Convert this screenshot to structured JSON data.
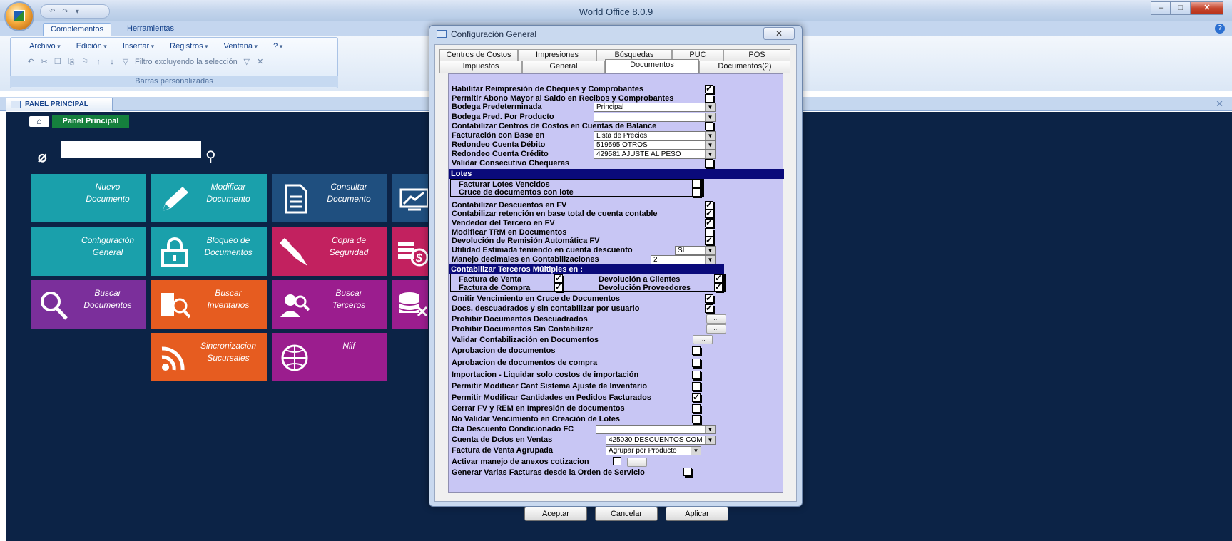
{
  "window": {
    "title": "World Office 8.0.9",
    "controls": [
      "minimize",
      "maximize",
      "close"
    ]
  },
  "ribbon": {
    "tabs": [
      "Complementos",
      "Herramientas"
    ],
    "active_tab": "Complementos",
    "menus": [
      "Archivo",
      "Edición",
      "Insertar",
      "Registros",
      "Ventana",
      "?"
    ],
    "filter_label": "Filtro excluyendo la selección",
    "group_label": "Barras personalizadas"
  },
  "doc_tab": {
    "title": "PANEL PRINCIPAL"
  },
  "panel": {
    "home_label": "Panel Principal",
    "search_value": "",
    "tiles": [
      {
        "label": "Nuevo\nDocumento",
        "icon": "new-document-icon",
        "color": "#1aa0ab"
      },
      {
        "label": "Modificar\nDocumento",
        "icon": "pencil-icon",
        "color": "#1aa0ab"
      },
      {
        "label": "Consultar\nDocumento",
        "icon": "document-icon",
        "color": "#1f4f7f"
      },
      {
        "label": "",
        "icon": "chart-icon",
        "color": "#1f4f7f"
      },
      {
        "label": "Configuración\nGeneral",
        "icon": "settings-icon",
        "color": "#1aa0ab"
      },
      {
        "label": "Bloqueo de\nDocumentos",
        "icon": "lock-icon",
        "color": "#1aa0ab"
      },
      {
        "label": "Copia de\nSeguridad",
        "icon": "usb-icon",
        "color": "#c2215f"
      },
      {
        "label": "",
        "icon": "money-icon",
        "color": "#c2215f"
      },
      {
        "label": "Buscar\nDocumentos",
        "icon": "magnifier-icon",
        "color": "#7b2f9b"
      },
      {
        "label": "Buscar\nInventarios",
        "icon": "inventory-search-icon",
        "color": "#e65c20"
      },
      {
        "label": "Buscar\nTerceros",
        "icon": "people-search-icon",
        "color": "#9b1d8e"
      },
      {
        "label": "",
        "icon": "database-icon",
        "color": "#9b1d8e"
      },
      {
        "label": "Sincronizacion\nSucursales",
        "icon": "rss-icon",
        "color": "#e65c20"
      },
      {
        "label": "Niif",
        "icon": "globe-icon",
        "color": "#9b1d8e"
      }
    ]
  },
  "dialog": {
    "title": "Configuración General",
    "tabs_row1": [
      "Centros de Costos",
      "Impresiones",
      "Búsquedas",
      "PUC",
      "POS"
    ],
    "tabs_row2": [
      "Impuestos",
      "General",
      "Documentos",
      "Documentos(2)"
    ],
    "active_tab": "Documentos",
    "rows": {
      "reimpresion": "Habilitar Reimpresión de Cheques y Comprobantes",
      "abono": "Permitir Abono Mayor al Saldo en Recibos y Comprobantes",
      "bodega": "Bodega Predeterminada",
      "bodega_value": "Principal",
      "bodega_prod": "Bodega Pred. Por Producto",
      "bodega_prod_value": "",
      "centros": "Contabilizar Centros de Costos en Cuentas de Balance",
      "facturacion": "Facturación con Base en",
      "facturacion_value": "Lista de Precios",
      "redondeo_deb": "Redondeo Cuenta Débito",
      "redondeo_deb_value": "519595 OTROS",
      "redondeo_cred": "Redondeo Cuenta Crédito",
      "redondeo_cred_value": "429581 AJUSTE AL PESO",
      "validar_chequeras": "Validar Consecutivo Chequeras",
      "lotes_header": "Lotes",
      "lotes_vencidos": "Facturar Lotes Vencidos",
      "lotes_cruce": "Cruce de documentos con lote",
      "descuentos_fv": "Contabilizar Descuentos en FV",
      "retencion": "Contabilizar retención en base total de cuenta contable",
      "vendedor": "Vendedor del Tercero en FV",
      "trm": "Modificar TRM en Documentos",
      "devolucion_rem": "Devolución de Remisión Automática FV",
      "utilidad": "Utilidad Estimada teniendo en cuenta descuento",
      "utilidad_value": "SI",
      "decimales": "Manejo decimales en Contabilizaciones",
      "decimales_value": "2",
      "terceros_header": "Contabilizar Terceros Múltiples en :",
      "factura_venta": "Factura de Venta",
      "factura_compra": "Factura de Compra",
      "devolucion_clientes": "Devolución a Clientes",
      "devolucion_proveedores": "Devolución Proveedores",
      "omitir_venc": "Omitir Vencimiento en Cruce de Documentos",
      "descuadrados_usuario": "Docs. descuadrados y sin contabilizar por usuario",
      "prohibir_descuadrados": "Prohibir Documentos Descuadrados",
      "prohibir_sin_cont": "Prohibir Documentos Sin Contabilizar",
      "validar_cont": "Validar Contabilización en Documentos",
      "aprobacion_docs": "Aprobacion de documentos",
      "aprobacion_compra": "Aprobacion de documentos de compra",
      "importacion": "Importacion - Liquidar solo costos de importación",
      "modificar_cant": "Permitir Modificar Cant Sistema Ajuste de Inventario",
      "modificar_pedidos": "Permitir Modificar Cantidades en Pedidos Facturados",
      "cerrar_fv": "Cerrar FV y REM en Impresión de documentos",
      "no_validar_venc": "No Validar Vencimiento en Creación de Lotes",
      "cta_descuento": "Cta Descuento Condicionado FC",
      "cta_descuento_value": "",
      "cuenta_dctos": "Cuenta de Dctos en Ventas",
      "cuenta_dctos_value": "425030 DESCUENTOS COM",
      "factura_agrupada": "Factura de Venta Agrupada",
      "factura_agrupada_value": "Agrupar por Producto",
      "anexos": "Activar manejo de anexos cotizacion",
      "varias_facturas": "Generar Varias Facturas desde la Orden de Servicio"
    },
    "ellipsis": "...",
    "buttons": {
      "accept": "Aceptar",
      "cancel": "Cancelar",
      "apply": "Aplicar"
    }
  }
}
